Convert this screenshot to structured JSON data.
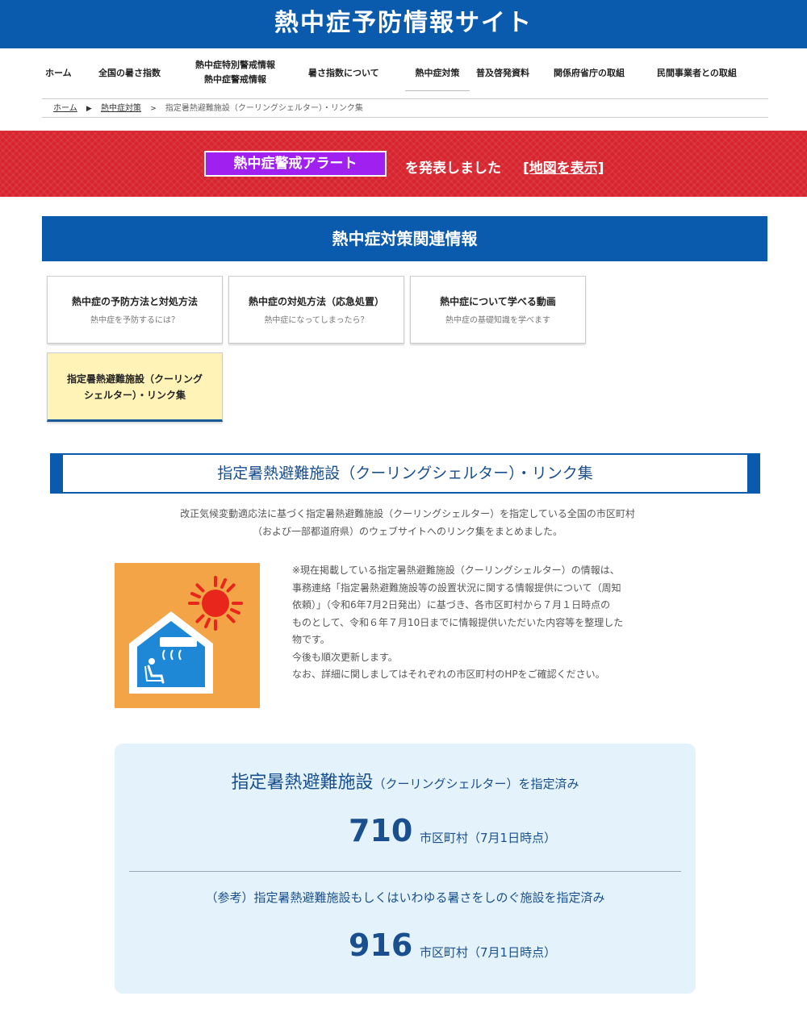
{
  "header": {
    "title": "熱中症予防情報サイト"
  },
  "nav": {
    "items": [
      {
        "label": "ホーム"
      },
      {
        "label": "全国の暑さ指数"
      },
      {
        "label_line1": "熱中症特別警戒情報",
        "label_line2": "熱中症警戒情報"
      },
      {
        "label": "暑さ指数について"
      },
      {
        "label": "熱中症対策"
      },
      {
        "label": "普及啓発資料"
      },
      {
        "label": "関係府省庁の取組"
      },
      {
        "label": "民間事業者との取組"
      }
    ]
  },
  "breadcrumb": {
    "home": "ホーム",
    "sep1": "▶",
    "parent": "熱中症対策",
    "sep2": ">",
    "current": "指定暑熱避難施設（クーリングシェルター）・リンク集"
  },
  "alert": {
    "button": "熱中症警戒アラート",
    "text": "を発表しました",
    "link": "[地図を表示]"
  },
  "section": {
    "title": "熱中症対策関連情報"
  },
  "cards": [
    {
      "title": "熱中症の予防方法と対処方法",
      "sub": "熱中症を予防するには？"
    },
    {
      "title": "熱中症の対処方法（応急処置）",
      "sub": "熱中症になってしまったら？"
    },
    {
      "title": "熱中症について学べる動画",
      "sub": "熱中症の基礎知識を学べます"
    },
    {
      "title_line1": "指定暑熱避難施設（クーリング",
      "title_line2": "シェルター）・リンク集"
    }
  ],
  "subhead": "指定暑熱避難施設（クーリングシェルター）・リンク集",
  "intro": {
    "line1": "改正気候変動適応法に基づく指定暑熱避難施設（クーリングシェルター）を指定している全国の市区町村",
    "line2": "（および一部都道府県）のウェブサイトへのリンク集をまとめました。"
  },
  "notes": {
    "lines": [
      "※現在掲載している指定暑熱避難施設（クーリングシェルター）の情報は、",
      "事務連絡「指定暑熱避難施設等の設置状況に関する情報提供について（周知",
      "依頼）」（令和6年7月2日発出）に基づき、各市区町村から７月１日時点の",
      "ものとして、令和６年７月10日までに情報提供いただいた内容等を整理した",
      "物です。",
      "今後も順次更新します。",
      "なお、詳細に関しましてはそれぞれの市区町村のHPをご確認ください。"
    ]
  },
  "stats": {
    "heading1_big": "指定暑熱避難施設",
    "heading1_small": "（クーリングシェルター）を指定済み",
    "count1": "710",
    "unit1": "市区町村（7月1日時点）",
    "heading2": "（参考）指定暑熱避難施設もしくはいわゆる暑さをしのぐ施設を指定済み",
    "count2": "916",
    "unit2": "市区町村（7月1日時点）"
  },
  "colors": {
    "primary": "#0a5aad",
    "alert_red": "#d7242e",
    "alert_purple": "#a020f0",
    "highlight": "#fff3b8",
    "stats_bg": "#e4f3fb",
    "illus_bg": "#f2a446"
  }
}
